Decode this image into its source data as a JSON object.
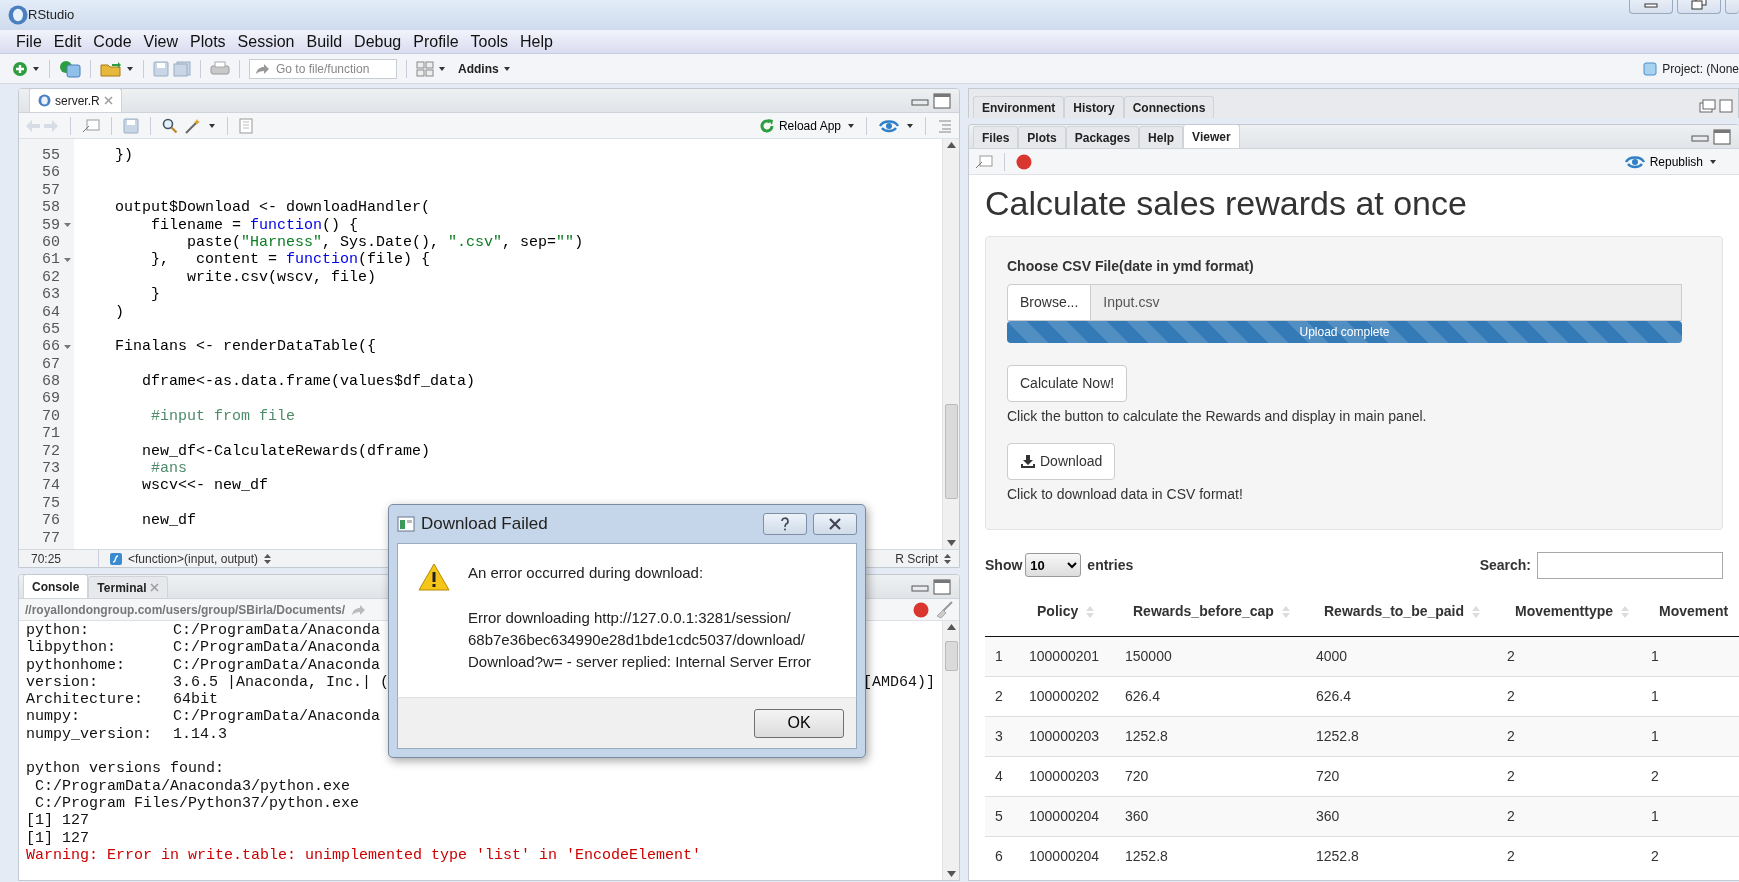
{
  "window": {
    "title": "RStudio"
  },
  "menu": [
    "File",
    "Edit",
    "Code",
    "View",
    "Plots",
    "Session",
    "Build",
    "Debug",
    "Profile",
    "Tools",
    "Help"
  ],
  "toolbar": {
    "goto_placeholder": "Go to file/function",
    "addins": "Addins",
    "project": "Project: (None"
  },
  "editor": {
    "tabs": [
      {
        "label": "server.R",
        "selected": true
      }
    ],
    "reload": "Reload App",
    "lines": [
      {
        "number": "55",
        "fold": false,
        "segments": [
          {
            "kind": "plain",
            "text": "    })"
          }
        ]
      },
      {
        "number": "56",
        "fold": false
      },
      {
        "number": "57",
        "fold": false
      },
      {
        "number": "58",
        "fold": false,
        "segments": [
          {
            "kind": "plain",
            "text": "    output$Download <- downloadHandler("
          }
        ]
      },
      {
        "number": "59",
        "fold": true,
        "segments": [
          {
            "kind": "plain",
            "text": "        filename = "
          },
          {
            "kind": "keyword",
            "text": "function"
          },
          {
            "kind": "plain",
            "text": "() {"
          }
        ]
      },
      {
        "number": "60",
        "fold": false,
        "segments": [
          {
            "kind": "plain",
            "text": "            paste("
          },
          {
            "kind": "string",
            "text": "\"Harness\""
          },
          {
            "kind": "plain",
            "text": ", Sys.Date(), "
          },
          {
            "kind": "string",
            "text": "\".csv\""
          },
          {
            "kind": "plain",
            "text": ", sep="
          },
          {
            "kind": "string",
            "text": "\"\""
          },
          {
            "kind": "plain",
            "text": ")"
          }
        ]
      },
      {
        "number": "61",
        "fold": true,
        "segments": [
          {
            "kind": "plain",
            "text": "        },   content = "
          },
          {
            "kind": "keyword",
            "text": "function"
          },
          {
            "kind": "plain",
            "text": "(file) {"
          }
        ]
      },
      {
        "number": "62",
        "fold": false,
        "segments": [
          {
            "kind": "plain",
            "text": "            write.csv(wscv, file)"
          }
        ]
      },
      {
        "number": "63",
        "fold": false,
        "segments": [
          {
            "kind": "plain",
            "text": "        }"
          }
        ]
      },
      {
        "number": "64",
        "fold": false,
        "segments": [
          {
            "kind": "plain",
            "text": "    )"
          }
        ]
      },
      {
        "number": "65",
        "fold": false
      },
      {
        "number": "66",
        "fold": true,
        "segments": [
          {
            "kind": "plain",
            "text": "    Finalans <- renderDataTable({"
          }
        ]
      },
      {
        "number": "67",
        "fold": false
      },
      {
        "number": "68",
        "fold": false,
        "segments": [
          {
            "kind": "plain",
            "text": "       dframe<-as.data.frame(values$df_data)"
          }
        ]
      },
      {
        "number": "69",
        "fold": false
      },
      {
        "number": "70",
        "fold": false,
        "segments": [
          {
            "kind": "comment",
            "text": "        #input from file"
          }
        ]
      },
      {
        "number": "71",
        "fold": false
      },
      {
        "number": "72",
        "fold": false,
        "segments": [
          {
            "kind": "plain",
            "text": "       new_df<-CalculateRewards(dframe)"
          }
        ]
      },
      {
        "number": "73",
        "fold": false,
        "segments": [
          {
            "kind": "comment",
            "text": "        #ans"
          }
        ]
      },
      {
        "number": "74",
        "fold": false,
        "segments": [
          {
            "kind": "plain",
            "text": "       wscv<<- new_df"
          }
        ]
      },
      {
        "number": "75",
        "fold": false
      },
      {
        "number": "76",
        "fold": false,
        "segments": [
          {
            "kind": "plain",
            "text": "       new_df"
          }
        ]
      },
      {
        "number": "77",
        "fold": false
      }
    ],
    "status": {
      "position": "70:25",
      "scope": "<function>(input, output)",
      "file_type": "R Script"
    }
  },
  "console": {
    "tabs": [
      {
        "label": "Console",
        "selected": true,
        "closable": false
      },
      {
        "label": "Terminal",
        "selected": false,
        "closable": true
      }
    ],
    "path": "//royallondongroup.com/users/group/SBirla/Documents/",
    "lines": [
      {
        "kind": "pair",
        "label": "python:",
        "value": "C:/ProgramData/Anaconda"
      },
      {
        "kind": "pair",
        "label": "libpython:",
        "value": "C:/ProgramData/Anaconda"
      },
      {
        "kind": "pair",
        "label": "pythonhome:",
        "value": "C:/ProgramData/Anaconda"
      },
      {
        "kind": "pair",
        "label": "version:",
        "value": "3.6.5 |Anaconda, Inc.| (",
        "tail": "[AMD64)]"
      },
      {
        "kind": "pair",
        "label": "Architecture:",
        "value": "64bit"
      },
      {
        "kind": "pair",
        "label": "numpy:",
        "value": "C:/ProgramData/Anaconda"
      },
      {
        "kind": "pair",
        "label": "numpy_version:",
        "value": "1.14.3"
      },
      {
        "kind": "blank"
      },
      {
        "kind": "text",
        "text": "python versions found:"
      },
      {
        "kind": "text",
        "text": " C:/ProgramData/Anaconda3/python.exe"
      },
      {
        "kind": "text",
        "text": " C:/Program Files/Python37/python.exe"
      },
      {
        "kind": "text",
        "text": "[1] 127"
      },
      {
        "kind": "text",
        "text": "[1] 127"
      },
      {
        "kind": "error",
        "text": "Warning: Error in write.table: unimplemented type 'list' in 'EncodeElement'"
      }
    ]
  },
  "dialog": {
    "title": "Download Failed",
    "message": "An error occurred during download:",
    "detail": [
      "Error downloading http://127.0.0.1:3281/session/",
      "68b7e36bec634990e28d1bde1cdc5037/download/",
      "Download?w= - server replied: Internal Server Error"
    ],
    "ok": "OK"
  },
  "env_tabs": [
    {
      "label": "Environment",
      "selected": false
    },
    {
      "label": "History",
      "selected": false
    },
    {
      "label": "Connections",
      "selected": false
    }
  ],
  "files_tabs": [
    {
      "label": "Files",
      "selected": false
    },
    {
      "label": "Plots",
      "selected": false
    },
    {
      "label": "Packages",
      "selected": false
    },
    {
      "label": "Help",
      "selected": false
    },
    {
      "label": "Viewer",
      "selected": true
    }
  ],
  "viewer": {
    "republish": "Republish",
    "title": "Calculate sales rewards at once",
    "file_label": "Choose CSV File(date in ymd format)",
    "browse": "Browse...",
    "filename": "Input.csv",
    "progress": {
      "label": "Upload complete",
      "level": 1
    },
    "calculate": "Calculate Now!",
    "calculate_help": "Click the button to calculate the Rewards and display in main panel.",
    "download": "Download",
    "download_help": "Click to download data in CSV format!",
    "table": {
      "show": "Show",
      "length": "10",
      "entries": "entries",
      "search_label": "Search:",
      "columns": [
        {
          "sortable": false
        },
        {
          "label": "Policy",
          "sortable": true
        },
        {
          "label": "Rewards_before_cap",
          "sortable": true
        },
        {
          "label": "Rewards_to_be_paid",
          "sortable": true
        },
        {
          "label": "Movementtype",
          "sortable": true
        },
        {
          "label": "Movement",
          "sortable": false
        }
      ],
      "rows": [
        [
          "1",
          "100000201",
          "150000",
          "4000",
          "2",
          "1"
        ],
        [
          "2",
          "100000202",
          "626.4",
          "626.4",
          "2",
          "1"
        ],
        [
          "3",
          "100000203",
          "1252.8",
          "1252.8",
          "2",
          "1"
        ],
        [
          "4",
          "100000203",
          "720",
          "720",
          "2",
          "2"
        ],
        [
          "5",
          "100000204",
          "360",
          "360",
          "2",
          "1"
        ],
        [
          "6",
          "100000204",
          "1252.8",
          "1252.8",
          "2",
          "2"
        ]
      ]
    }
  }
}
